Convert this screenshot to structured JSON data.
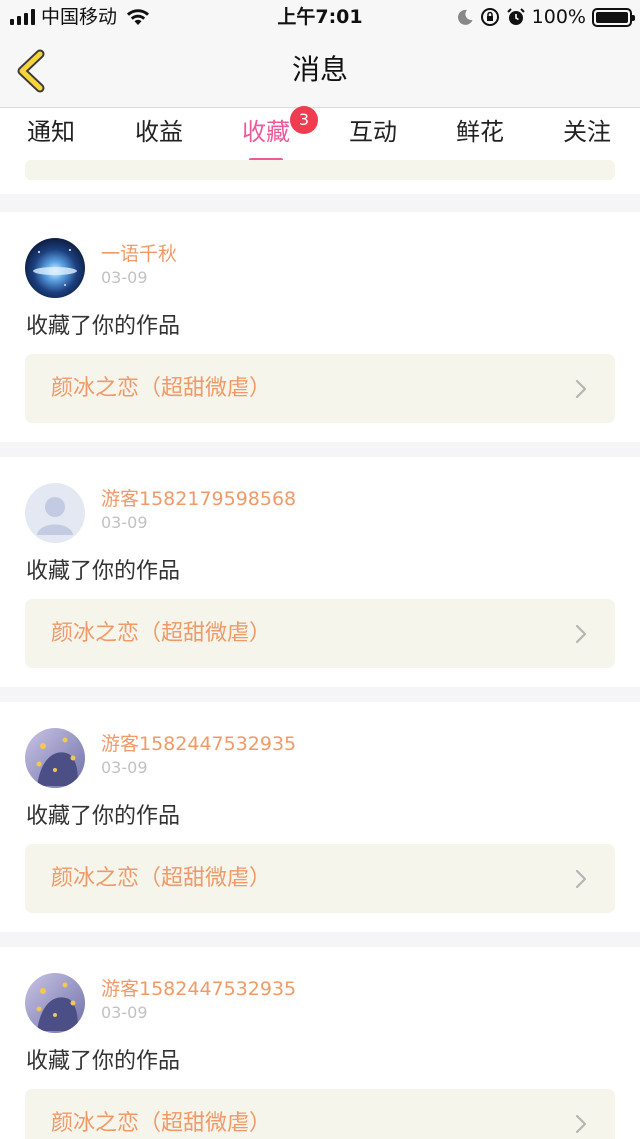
{
  "status_bar": {
    "carrier": "中国移动",
    "time": "上午7:01",
    "battery": "100%",
    "icons": [
      "signal-icon",
      "wifi-icon",
      "moon-icon",
      "rotation-lock-icon",
      "alarm-icon",
      "battery-icon"
    ]
  },
  "nav": {
    "title": "消息",
    "back_icon": "chevron-left-icon",
    "accent": "#f5d53a"
  },
  "tabs": [
    {
      "label": "通知"
    },
    {
      "label": "收益"
    },
    {
      "label": "收藏",
      "badge": "3"
    },
    {
      "label": "互动"
    },
    {
      "label": "鲜花"
    },
    {
      "label": "关注"
    }
  ],
  "active_tab": "收藏",
  "colors": {
    "tab_active": "#ec5c9c",
    "badge": "#f03c50",
    "name": "#f09a68",
    "card_bg": "#f6f5ec"
  },
  "items": [
    {
      "name": "一语千秋",
      "date": "03-09",
      "action": "收藏了你的作品",
      "work": "颜冰之恋（超甜微虐）",
      "avatar": "galaxy-avatar"
    },
    {
      "name": "游客1582179598568",
      "date": "03-09",
      "action": "收藏了你的作品",
      "work": "颜冰之恋（超甜微虐）",
      "avatar": "default-user-avatar"
    },
    {
      "name": "游客1582447532935",
      "date": "03-09",
      "action": "收藏了你的作品",
      "work": "颜冰之恋（超甜微虐）",
      "avatar": "illustration-avatar"
    },
    {
      "name": "游客1582447532935",
      "date": "03-09",
      "action": "收藏了你的作品",
      "work": "颜冰之恋（超甜微虐）",
      "avatar": "illustration-avatar"
    }
  ]
}
